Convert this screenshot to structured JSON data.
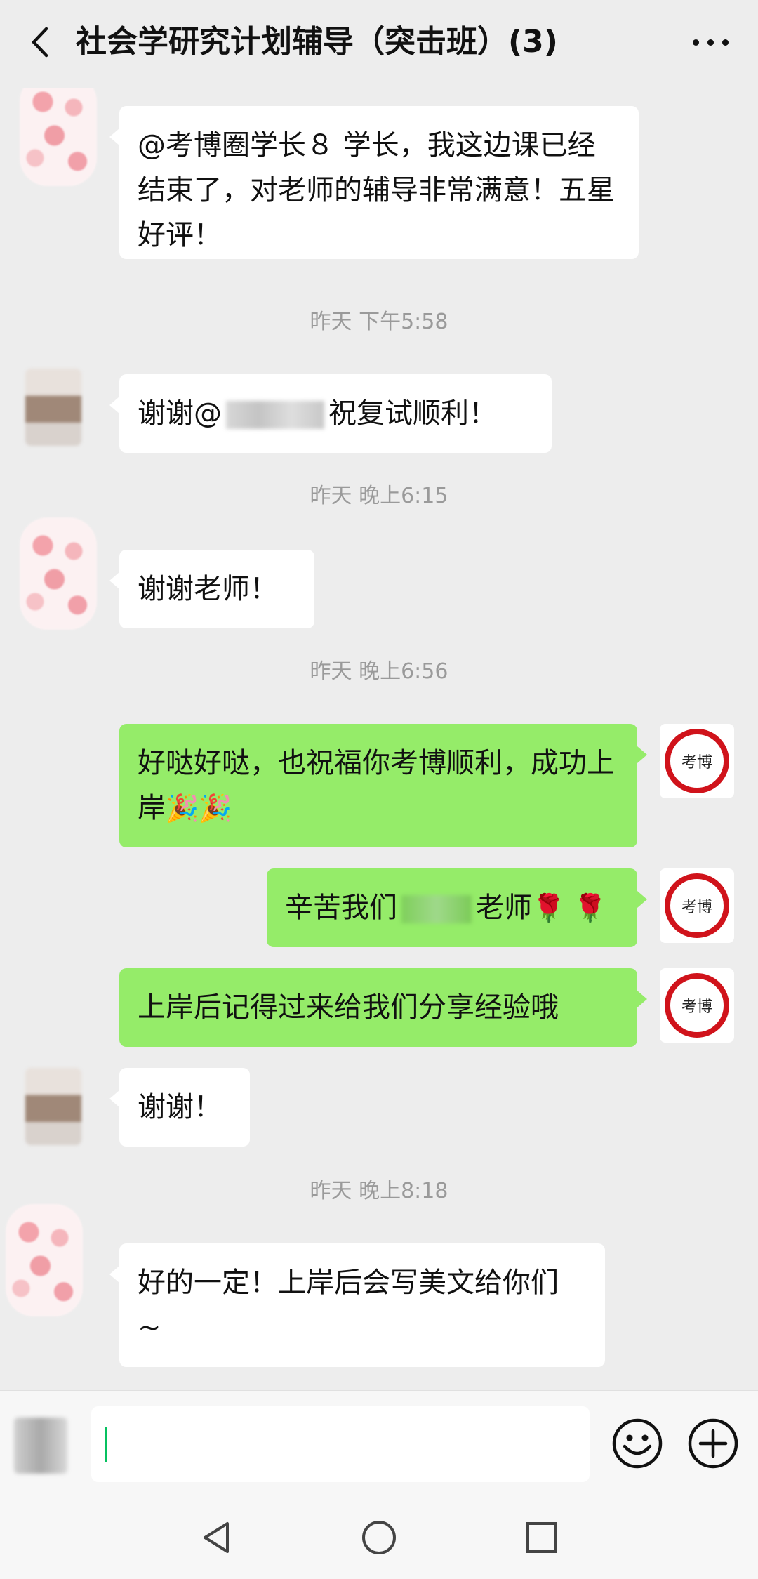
{
  "header": {
    "title": "社会学研究计划辅导（突击班）(3)"
  },
  "messages": [
    {
      "side": "left",
      "text": "@考博圈学长８ 学长，我这边课已经结束了，对老师的辅导非常满意！五星好评！"
    },
    {
      "timestamp": "昨天 下午5:58"
    },
    {
      "side": "left",
      "prefix": "谢谢@",
      "suffix": "祝复试顺利！"
    },
    {
      "timestamp": "昨天 晚上6:15"
    },
    {
      "side": "left",
      "text": "谢谢老师！"
    },
    {
      "timestamp": "昨天 晚上6:56"
    },
    {
      "side": "right",
      "text": "好哒好哒，也祝福你考博顺利，成功上岸",
      "emoji": "🎉🎉"
    },
    {
      "side": "right",
      "prefix": "辛苦我们",
      "suffix": "老师",
      "emoji": "🌹 🌹"
    },
    {
      "side": "right",
      "text": "上岸后记得过来给我们分享经验哦"
    },
    {
      "side": "left",
      "text": "谢谢！"
    },
    {
      "timestamp": "昨天 晚上8:18"
    },
    {
      "side": "left",
      "text": "好的一定！上岸后会写美文给你们 ~"
    }
  ],
  "avatar_right_text": "考博",
  "input": {
    "value": ""
  },
  "icons": {
    "back": "chevron-left-icon",
    "more": "more-dots-icon",
    "emoji": "smiley-icon",
    "plus": "plus-circle-icon",
    "nav_back": "triangle-back-icon",
    "nav_home": "circle-home-icon",
    "nav_recent": "square-recent-icon"
  },
  "colors": {
    "background": "#ededed",
    "bubble_self": "#95ec69",
    "bubble_other": "#ffffff",
    "timestamp": "#9a9a9a",
    "avatar_ring": "#d0131b"
  }
}
